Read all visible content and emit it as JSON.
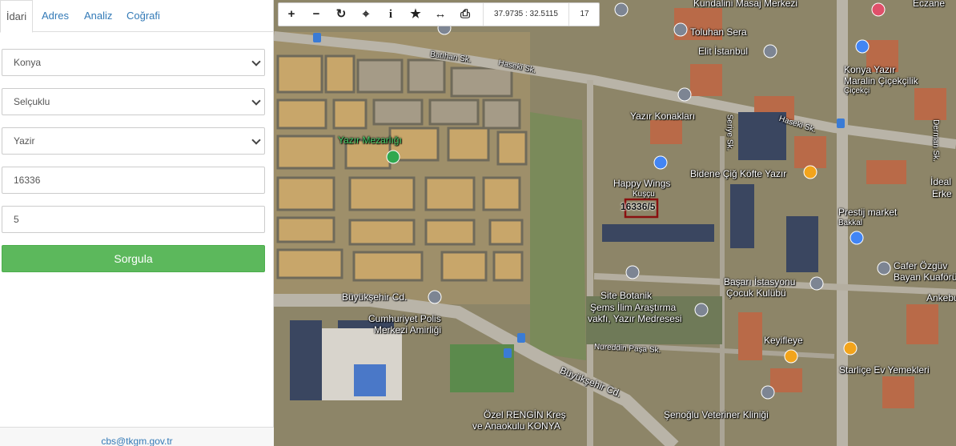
{
  "tabs": [
    "İdari",
    "Adres",
    "Analiz",
    "Coğrafi"
  ],
  "form": {
    "province": "Konya",
    "district": "Selçuklu",
    "neighborhood": "Yazir",
    "block": "16336",
    "parcel": "5",
    "query_label": "Sorgula"
  },
  "footer": {
    "email": "cbs@tkgm.gov.tr"
  },
  "toolbar": {
    "coordinates": "37.9735 : 32.5115",
    "zoom": "17"
  },
  "map": {
    "parcel_label": "16336/5",
    "labels": {
      "kundalini": "Kundalini Masaj Merkezi",
      "eczane": "Eczane",
      "toluhan": "Toluhan Sera",
      "elit": "Elit İstanbul",
      "marali": "Konya Yazır",
      "marali2": "Maralin Çiçekçilik",
      "cicekci": "Çiçekçi",
      "batihan": "Batıhan Sk.",
      "haseki1": "Haseki Sk.",
      "haseki2": "Haseki Sk.",
      "konaklari": "Yazır Konakları",
      "seriye": "Seriye Sk.",
      "mezarlik": "Yazır Mezarlığı",
      "happy": "Happy Wings",
      "kuscu": "Kuşçu",
      "bidene": "Bidene Çiğ Köfte Yazır",
      "dermen": "Derman Sk.",
      "ideal": "İdeal",
      "erke": "Erke",
      "prestij": "Prestij market",
      "bakkal": "Bakkal",
      "cafer": "Cafer Özgüv",
      "bayan": "Bayan Kuaförü",
      "basari": "Başarı İstasyonu",
      "cocuk": "Çocuk Kulübü",
      "ankebut": "Ankebu",
      "buyuksehir1": "Büyükşehir Cd.",
      "cumhuriyet": "Cumhuriyet Polis",
      "merkezi": "Merkezi Amirliği",
      "botanik": "Site Botanik",
      "sems": "Şems İlim Araştırma",
      "vakfi": "vakfı, Yazır Medresesi",
      "nureddin": "Nureddin Paşa Sk.",
      "keyifleye": "Keyifleye",
      "starlice": "Starliçe Ev Yemekleri",
      "buyuksehir2": "Büyükşehir Cd.",
      "ozel": "Özel RENGİN Kreş",
      "anaokulu": "ve Anaokulu KONYA",
      "senoglu": "Şenoğlu Veteriner Kliniği"
    }
  }
}
